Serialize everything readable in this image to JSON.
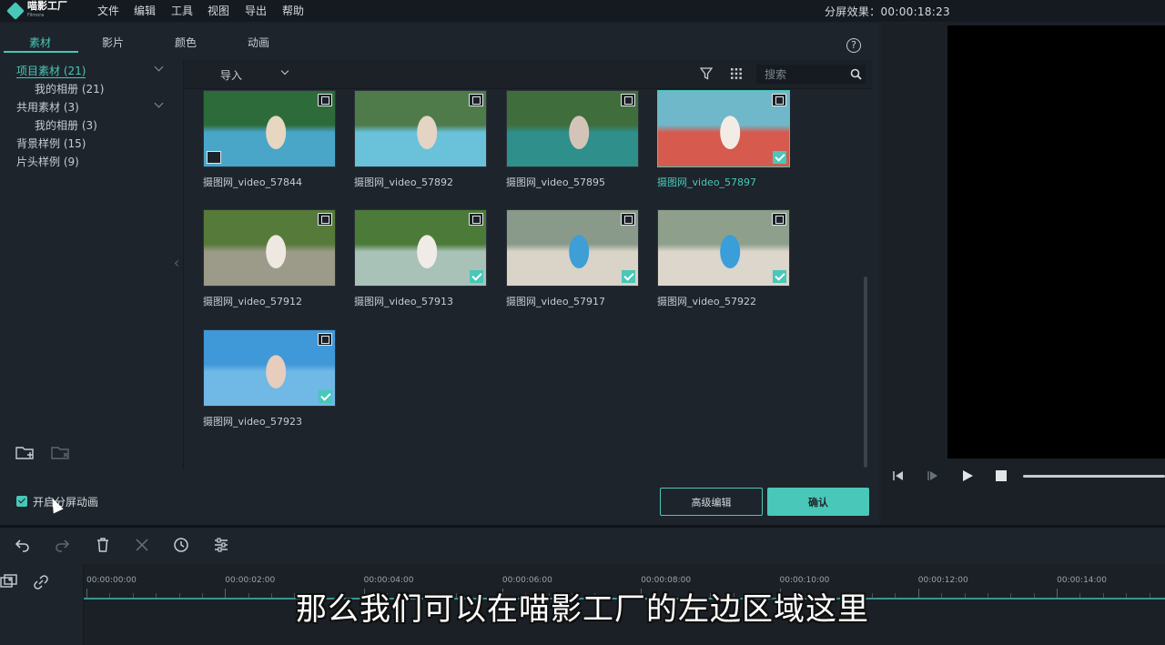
{
  "app": {
    "logo_text": "喵影工厂",
    "logo_subtext": "Filmora"
  },
  "menu": [
    "文件",
    "编辑",
    "工具",
    "视图",
    "导出",
    "帮助"
  ],
  "split_effect": "分屏效果：00:00:18:23",
  "tabs": [
    "素材",
    "影片",
    "颜色",
    "动画"
  ],
  "tree": [
    {
      "label": "项目素材 (21)",
      "selected": true
    },
    {
      "label": "我的相册 (21)"
    },
    {
      "label": "共用素材 (3)"
    },
    {
      "label": "我的相册 (3)"
    },
    {
      "label": "背景样例 (15)"
    },
    {
      "label": "片头样例 (9)"
    }
  ],
  "toolbar": {
    "import_label": "导入",
    "search_placeholder": "搜索"
  },
  "clips": [
    {
      "name": "摄图网_video_57844",
      "checked": false,
      "selected": false,
      "pip": true,
      "colors": [
        "#2d6b3a",
        "#4aa6c9",
        "#e8d7c0"
      ]
    },
    {
      "name": "摄图网_video_57892",
      "checked": false,
      "selected": false,
      "pip": false,
      "colors": [
        "#4f7a4a",
        "#69c2da",
        "#e4d4c4"
      ]
    },
    {
      "name": "摄图网_video_57895",
      "checked": false,
      "selected": false,
      "pip": false,
      "colors": [
        "#3f6d3c",
        "#2f8f8a",
        "#d4c4b8"
      ]
    },
    {
      "name": "摄图网_video_57897",
      "checked": true,
      "selected": true,
      "pip": false,
      "colors": [
        "#6fb8c9",
        "#d65a4e",
        "#f2ece4"
      ]
    },
    {
      "name": "摄图网_video_57912",
      "checked": false,
      "selected": false,
      "pip": false,
      "colors": [
        "#567a3a",
        "#9c9a88",
        "#eee8e0"
      ]
    },
    {
      "name": "摄图网_video_57913",
      "checked": true,
      "selected": false,
      "pip": false,
      "colors": [
        "#4c7a38",
        "#a8c2b8",
        "#f0ebe6"
      ]
    },
    {
      "name": "摄图网_video_57917",
      "checked": true,
      "selected": false,
      "pip": false,
      "colors": [
        "#8a9a8a",
        "#d9d3c8",
        "#3d9fd6"
      ]
    },
    {
      "name": "摄图网_video_57922",
      "checked": true,
      "selected": false,
      "pip": false,
      "colors": [
        "#8ea08c",
        "#dcd6cc",
        "#3a9ed8"
      ]
    },
    {
      "name": "摄图网_video_57923",
      "checked": true,
      "selected": false,
      "pip": false,
      "colors": [
        "#3f98d8",
        "#70b8e6",
        "#e6cdbd"
      ]
    }
  ],
  "split_animation": {
    "label": "开启分屏动画",
    "checked": true
  },
  "buttons": {
    "advanced": "高级编辑",
    "confirm": "确认"
  },
  "timeline": {
    "ticks": [
      "00:00:00:00",
      "00:00:02:00",
      "00:00:04:00",
      "00:00:06:00",
      "00:00:08:00",
      "00:00:10:00",
      "00:00:12:00",
      "00:00:14:00"
    ]
  },
  "subtitle": "那么我们可以在喵影工厂的左边区域这里",
  "colors": {
    "accent": "#49c7b8",
    "background": "#1d242b",
    "menubar": "#141a20"
  }
}
